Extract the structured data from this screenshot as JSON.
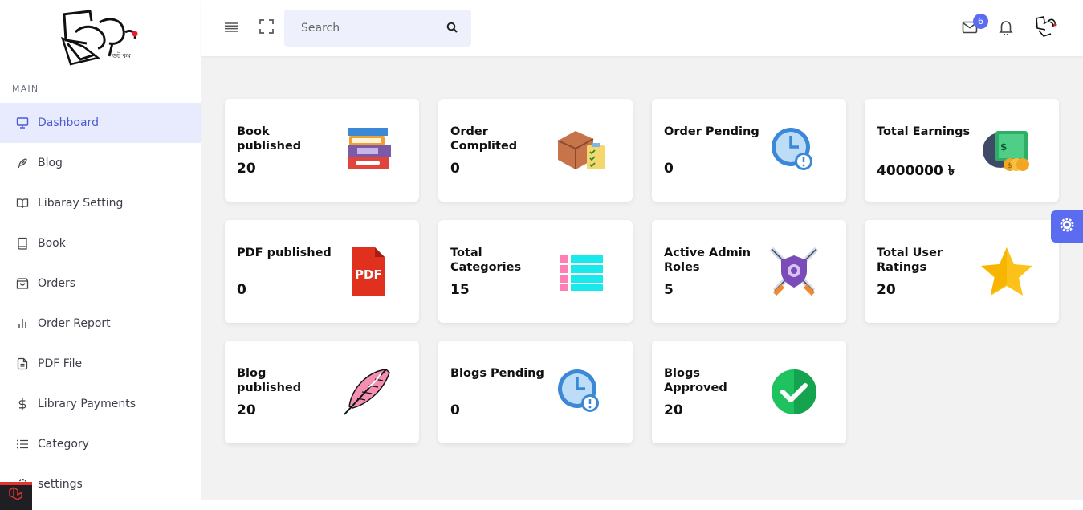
{
  "sidebar": {
    "section_label": "MAIN",
    "items": [
      {
        "label": "Dashboard",
        "icon": "monitor-icon"
      },
      {
        "label": "Blog",
        "icon": "feather-icon"
      },
      {
        "label": "Libaray Setting",
        "icon": "book-open-icon"
      },
      {
        "label": "Book",
        "icon": "book-icon"
      },
      {
        "label": "Orders",
        "icon": "shopping-bag-icon"
      },
      {
        "label": "Order Report",
        "icon": "bar-chart-icon"
      },
      {
        "label": "PDF File",
        "icon": "file-text-icon"
      },
      {
        "label": "Library Payments",
        "icon": "dollar-icon"
      },
      {
        "label": "Category",
        "icon": "list-icon"
      },
      {
        "label": "settings",
        "icon": "gear-icon"
      }
    ]
  },
  "header": {
    "search_placeholder": "Search",
    "mail_badge": "6"
  },
  "cards": [
    {
      "title": "Book published",
      "value": "20",
      "icon": "books-stack-icon"
    },
    {
      "title": "Order Complited",
      "value": "0",
      "icon": "box-checklist-icon"
    },
    {
      "title": "Order Pending",
      "value": "0",
      "icon": "clock-alert-icon"
    },
    {
      "title": "Total Earnings",
      "value": "4000000 ৳",
      "icon": "money-coins-icon"
    },
    {
      "title": "PDF published",
      "value": "0",
      "icon": "pdf-file-icon"
    },
    {
      "title": "Total Categories",
      "value": "15",
      "icon": "category-list-icon"
    },
    {
      "title": "Active Admin Roles",
      "value": "5",
      "icon": "shield-swords-icon"
    },
    {
      "title": "Total User Ratings",
      "value": "20",
      "icon": "star-icon"
    },
    {
      "title": "Blog published",
      "value": "20",
      "icon": "quill-feather-icon"
    },
    {
      "title": "Blogs Pending",
      "value": "0",
      "icon": "clock-alert-icon"
    },
    {
      "title": "Blogs Approved",
      "value": "20",
      "icon": "check-circle-icon"
    }
  ],
  "colors": {
    "accent": "#5b6cf0",
    "active_bg": "#e8ebfd",
    "active_text": "#4c5bd4"
  }
}
